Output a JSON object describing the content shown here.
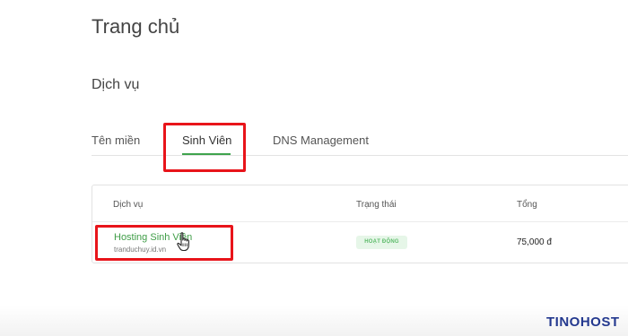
{
  "page": {
    "title": "Trang chủ",
    "section_title": "Dịch vụ"
  },
  "tabs": [
    {
      "label": "Tên miền"
    },
    {
      "label": "Sinh Viên",
      "active": true
    },
    {
      "label": "DNS Management"
    }
  ],
  "table": {
    "headers": [
      "Dịch vụ",
      "Trạng thái",
      "Tổng"
    ],
    "rows": [
      {
        "service": "Hosting Sinh Viên",
        "domain": "tranduchuy.id.vn",
        "status": "HOẠT ĐỘNG",
        "total": "75,000 đ"
      }
    ]
  },
  "watermark": {
    "text": "TINOHOST"
  },
  "colors": {
    "accent": "#3fa34d",
    "highlight": "#e8141a",
    "brand": "#24398f",
    "badge_bg": "#e6f6e8"
  }
}
